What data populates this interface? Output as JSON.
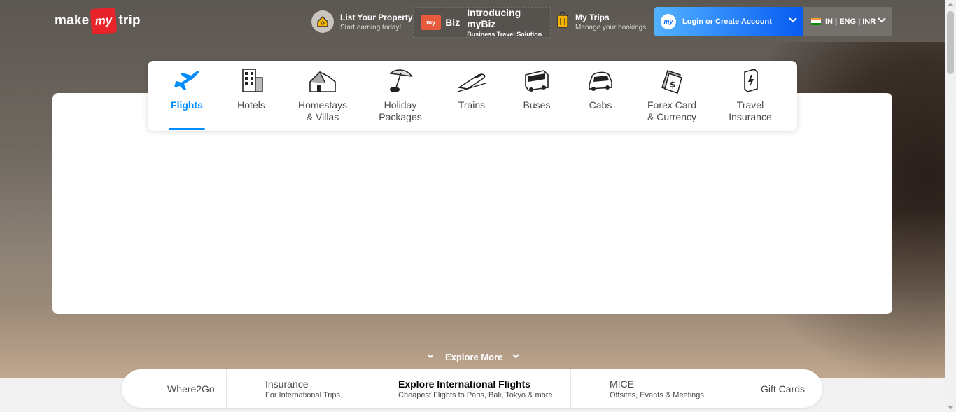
{
  "brand": {
    "make": "make",
    "my": "my",
    "trip": "trip"
  },
  "header": {
    "list_property": {
      "title": "List Your Property",
      "subtitle": "Start earning today!"
    },
    "mybiz": {
      "badge": "my",
      "biz": "Biz",
      "title": "Introducing myBiz",
      "subtitle": "Business Travel Solution"
    },
    "my_trips": {
      "title": "My Trips",
      "subtitle": "Manage your bookings"
    },
    "login": {
      "avatar": "my",
      "label": "Login or Create Account"
    },
    "locale": {
      "label": "IN | ENG | INR"
    }
  },
  "nav": {
    "active": "Flights",
    "items": [
      {
        "label": "Flights",
        "icon": "airplane-icon"
      },
      {
        "label": "Hotels",
        "icon": "hotel-building-icon"
      },
      {
        "label": "Homestays\n& Villas",
        "icon": "house-icon"
      },
      {
        "label": "Holiday\nPackages",
        "icon": "beach-umbrella-icon"
      },
      {
        "label": "Trains",
        "icon": "train-icon"
      },
      {
        "label": "Buses",
        "icon": "bus-icon"
      },
      {
        "label": "Cabs",
        "icon": "car-icon"
      },
      {
        "label": "Forex Card\n& Currency",
        "icon": "forex-card-icon"
      },
      {
        "label": "Travel\nInsurance",
        "icon": "insurance-icon"
      }
    ]
  },
  "explore_more": "Explore More",
  "bottom_bar": [
    {
      "title": "Where2Go",
      "subtitle": ""
    },
    {
      "title": "Insurance",
      "subtitle": "For International Trips"
    },
    {
      "title": "Explore International Flights",
      "subtitle": "Cheapest Flights to Paris, Bali, Tokyo & more"
    },
    {
      "title": "MICE",
      "subtitle": "Offsites, Events & Meetings"
    },
    {
      "title": "Gift Cards",
      "subtitle": ""
    }
  ],
  "colors": {
    "accent": "#008cff",
    "brand_red": "#e8232a",
    "login_start": "#53b2fe",
    "login_end": "#065af3"
  }
}
